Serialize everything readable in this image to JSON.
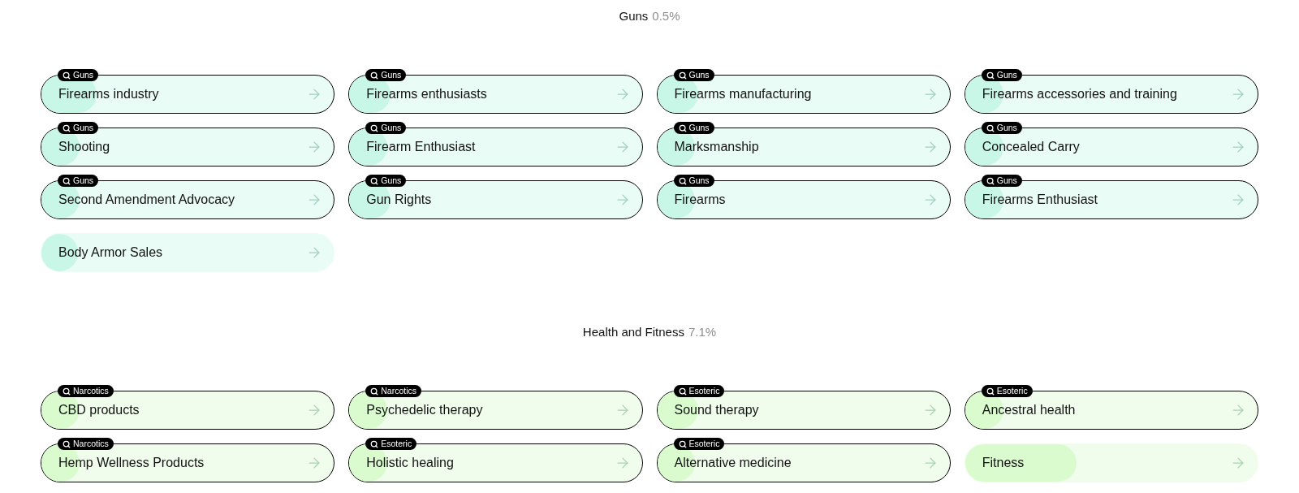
{
  "sections": [
    {
      "title": "Guns",
      "share": "0.5%",
      "color": "#c9f7e7",
      "items": [
        {
          "label": "Firearms industry",
          "tag": "Guns",
          "level": 0.19
        },
        {
          "label": "Firearms enthusiasts",
          "tag": "Guns",
          "level": 0.14
        },
        {
          "label": "Firearms manufacturing",
          "tag": "Guns",
          "level": 0.14
        },
        {
          "label": "Firearms accessories and training",
          "tag": "Guns",
          "level": 0.13
        },
        {
          "label": "Shooting",
          "tag": "Guns",
          "level": 0.13
        },
        {
          "label": "Firearm Enthusiast",
          "tag": "Guns",
          "level": 0.13
        },
        {
          "label": "Marksmanship",
          "tag": "Guns",
          "level": 0.13
        },
        {
          "label": "Concealed Carry",
          "tag": "Guns",
          "level": 0.13
        },
        {
          "label": "Second Amendment Advocacy",
          "tag": "Guns",
          "level": 0.13
        },
        {
          "label": "Gun Rights",
          "tag": "Guns",
          "level": 0.14
        },
        {
          "label": "Firearms",
          "tag": "Guns",
          "level": 0.13
        },
        {
          "label": "Firearms Enthusiast",
          "tag": "Guns",
          "level": 0.13
        },
        {
          "label": "Body Armor Sales",
          "level": 0.12
        }
      ]
    },
    {
      "title": "Health and Fitness",
      "share": "7.1%",
      "color": "#d9fbcd",
      "items": [
        {
          "label": "CBD products",
          "tag": "Narcotics",
          "level": 0.13
        },
        {
          "label": "Psychedelic therapy",
          "tag": "Narcotics",
          "level": 0.13
        },
        {
          "label": "Sound therapy",
          "tag": "Esoteric",
          "level": 0.14
        },
        {
          "label": "Ancestral health",
          "tag": "Esoteric",
          "level": 0.13
        },
        {
          "label": "Hemp Wellness Products",
          "tag": "Narcotics",
          "level": 0.13
        },
        {
          "label": "Holistic healing",
          "tag": "Esoteric",
          "level": 0.13
        },
        {
          "label": "Alternative medicine",
          "tag": "Esoteric",
          "level": 0.13
        },
        {
          "label": "Fitness",
          "level": 0.38
        }
      ]
    }
  ]
}
